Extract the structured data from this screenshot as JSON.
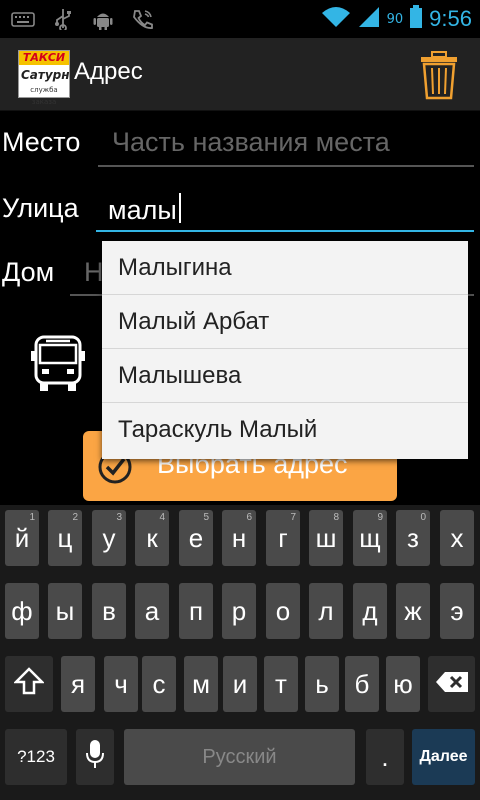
{
  "status": {
    "battery_percent": "90",
    "time": "9:56"
  },
  "actionbar": {
    "logo_line1": "ТАКСИ",
    "logo_line2": "Сатурн",
    "logo_line3": "служба заказа",
    "title": "Адрес"
  },
  "form": {
    "place_label": "Место",
    "place_placeholder": "Часть названия места",
    "street_label": "Улица",
    "street_value": "малы",
    "house_label": "Дом",
    "house_placeholder": "Н"
  },
  "suggestions": [
    "Малыгина",
    "Малый Арбат",
    "Малышева",
    "Тараскуль Малый"
  ],
  "select_button": "Выбрать адрес",
  "keyboard": {
    "row1": [
      {
        "k": "й",
        "h": "1"
      },
      {
        "k": "ц",
        "h": "2"
      },
      {
        "k": "у",
        "h": "3"
      },
      {
        "k": "к",
        "h": "4"
      },
      {
        "k": "е",
        "h": "5"
      },
      {
        "k": "н",
        "h": "6"
      },
      {
        "k": "г",
        "h": "7"
      },
      {
        "k": "ш",
        "h": "8"
      },
      {
        "k": "щ",
        "h": "9"
      },
      {
        "k": "з",
        "h": "0"
      },
      {
        "k": "х",
        "h": ""
      }
    ],
    "row2": [
      "ф",
      "ы",
      "в",
      "а",
      "п",
      "р",
      "о",
      "л",
      "д",
      "ж",
      "э"
    ],
    "row3": [
      "я",
      "ч",
      "с",
      "м",
      "и",
      "т",
      "ь",
      "б",
      "ю"
    ],
    "symbols_key": "?123",
    "space_label": "Русский",
    "period_key": ".",
    "enter_key": "Далее"
  },
  "colors": {
    "accent": "#33b5e5",
    "button": "#fba544",
    "trash": "#f0a030"
  }
}
